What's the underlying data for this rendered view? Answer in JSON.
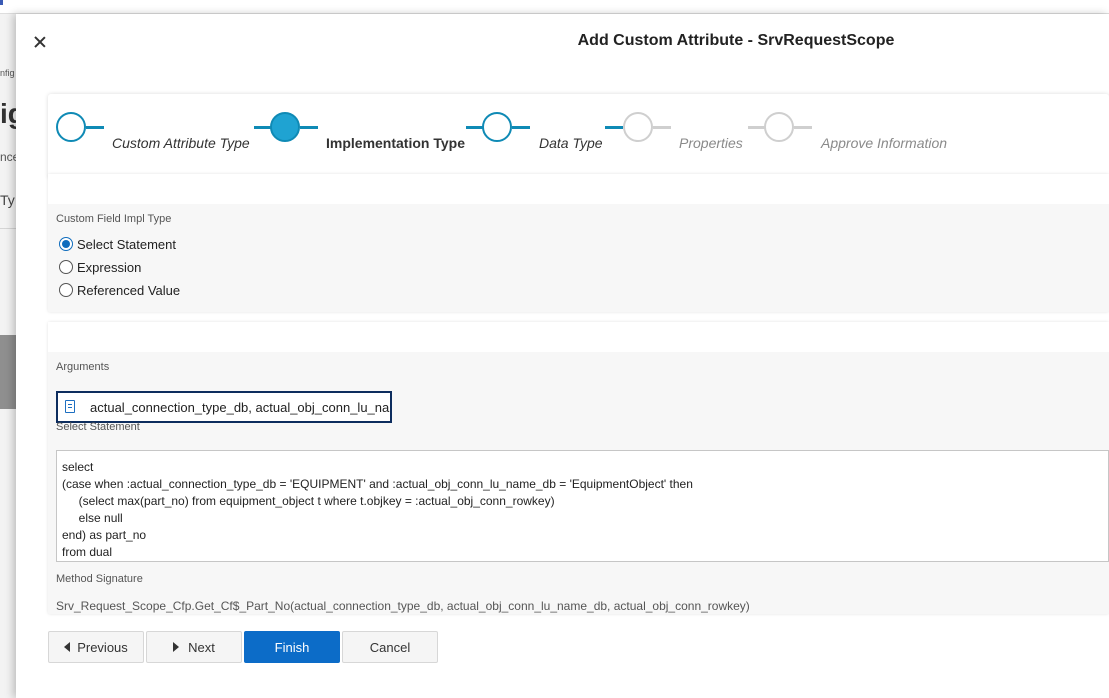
{
  "background_page": {
    "fragments": [
      "nfig",
      "ig",
      "nce",
      "Ty"
    ]
  },
  "dialog": {
    "title": "Add Custom Attribute - SrvRequestScope",
    "close_icon": "close-icon"
  },
  "stepper": {
    "steps": [
      {
        "label": "Custom Attribute Type",
        "state": "completed"
      },
      {
        "label": "Implementation Type",
        "state": "active"
      },
      {
        "label": "Data Type",
        "state": "completed"
      },
      {
        "label": "Properties",
        "state": "disabled"
      },
      {
        "label": "Approve Information",
        "state": "disabled"
      }
    ]
  },
  "impl_type": {
    "label": "Custom Field Impl Type",
    "options": [
      "Select Statement",
      "Expression",
      "Referenced Value"
    ],
    "selected": "Select Statement"
  },
  "arguments": {
    "label": "Arguments",
    "value": "actual_connection_type_db, actual_obj_conn_lu_name_db, actual_obj_conn_rowkey",
    "icon": "document-icon"
  },
  "select_statement": {
    "label": "Select Statement",
    "lines": [
      "select",
      "(case when :actual_connection_type_db = 'EQUIPMENT' and :actual_obj_conn_lu_name_db = 'EquipmentObject' then",
      "     (select max(part_no) from equipment_object t where t.objkey = :actual_obj_conn_rowkey)",
      "     else null",
      "end) as part_no",
      "from dual"
    ]
  },
  "method_signature": {
    "label": "Method Signature",
    "value": "Srv_Request_Scope_Cfp.Get_Cf$_Part_No(actual_connection_type_db, actual_obj_conn_lu_name_db, actual_obj_conn_rowkey)"
  },
  "footer": {
    "previous_label": "Previous",
    "next_label": "Next",
    "finish_label": "Finish",
    "cancel_label": "Cancel"
  },
  "colors": {
    "accent": "#0f8ab5",
    "active_step_fill": "#1fa3d2",
    "primary_button": "#0c6cc8",
    "disabled": "#cfcfcf"
  }
}
